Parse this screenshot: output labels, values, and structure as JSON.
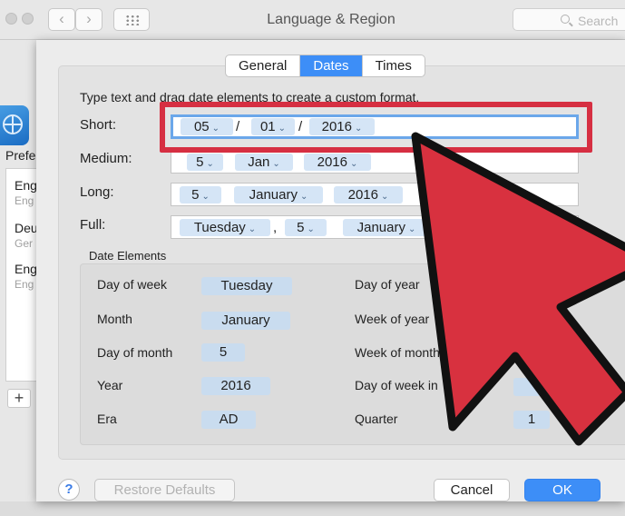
{
  "window": {
    "title": "Language & Region",
    "nav_back": "‹",
    "nav_forward": "›",
    "search_placeholder": "Search"
  },
  "background": {
    "preferred_label": "Prefe",
    "languages": [
      {
        "name": "Eng",
        "sub": "Eng"
      },
      {
        "name": "Deu",
        "sub": "Ger"
      },
      {
        "name": "Eng",
        "sub": "Eng"
      }
    ],
    "add_label": "+"
  },
  "tabs": [
    {
      "label": "General",
      "active": false
    },
    {
      "label": "Dates",
      "active": true
    },
    {
      "label": "Times",
      "active": false
    }
  ],
  "instruction": "Type text and drag date elements to create a custom format.",
  "formats": {
    "short": {
      "label": "Short:",
      "day": "05",
      "month": "01",
      "year": "2016",
      "sep": "/"
    },
    "medium": {
      "label": "Medium:",
      "day": "5",
      "month": "Jan",
      "year": "2016"
    },
    "long": {
      "label": "Long:",
      "day": "5",
      "month": "January",
      "year": "2016"
    },
    "full": {
      "label": "Full:",
      "weekday": "Tuesday",
      "comma": ",",
      "day": "5",
      "month": "January"
    }
  },
  "date_elements": {
    "title": "Date Elements",
    "left": [
      {
        "label": "Day of week",
        "value": "Tuesday"
      },
      {
        "label": "Month",
        "value": "January"
      },
      {
        "label": "Day of month",
        "value": "5"
      },
      {
        "label": "Year",
        "value": "2016"
      },
      {
        "label": "Era",
        "value": "AD"
      }
    ],
    "right": [
      {
        "label": "Day of year",
        "value": ""
      },
      {
        "label": "Week of year",
        "value": ""
      },
      {
        "label": "Week of month",
        "value": ""
      },
      {
        "label": "Day of week in",
        "value": ""
      },
      {
        "label": "Quarter",
        "value": "1"
      }
    ]
  },
  "buttons": {
    "help": "?",
    "restore": "Restore Defaults",
    "cancel": "Cancel",
    "ok": "OK"
  },
  "colors": {
    "accent": "#3d8ef7",
    "highlight_red": "#d62f42",
    "token_blue": "#d5e5f6"
  }
}
